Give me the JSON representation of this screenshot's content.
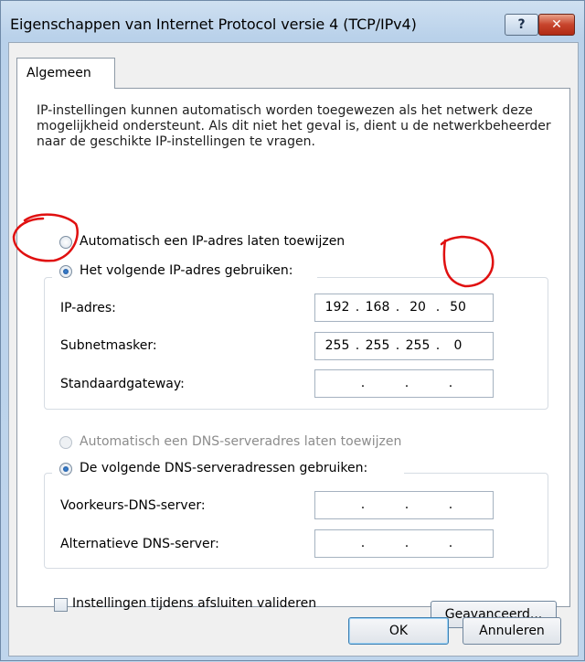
{
  "window": {
    "title": "Eigenschappen van Internet Protocol versie 4 (TCP/IPv4)",
    "help_label": "?",
    "close_label": "✕"
  },
  "tabs": [
    {
      "label": "Algemeen",
      "selected": true
    }
  ],
  "intro_text": "IP-instellingen kunnen automatisch worden toegewezen als het netwerk deze mogelijkheid ondersteunt. Als dit niet het geval is, dient u de netwerkbeheerder naar de geschikte IP-instellingen te vragen.",
  "ip_options": {
    "auto": {
      "label": "Automatisch een IP-adres laten toewijzen",
      "checked": false
    },
    "manual": {
      "label": "Het volgende IP-adres gebruiken:",
      "checked": true
    }
  },
  "ip_fields": {
    "ip": {
      "label": "IP-adres:",
      "octets": [
        "192",
        "168",
        "20",
        "50"
      ]
    },
    "subnet": {
      "label": "Subnetmasker:",
      "octets": [
        "255",
        "255",
        "255",
        "0"
      ]
    },
    "gateway": {
      "label": "Standaardgateway:",
      "octets": [
        "",
        "",
        "",
        ""
      ]
    }
  },
  "dns_options": {
    "auto": {
      "label": "Automatisch een DNS-serveradres laten toewijzen",
      "checked": false,
      "disabled": true
    },
    "manual": {
      "label": "De volgende DNS-serveradressen gebruiken:",
      "checked": true
    }
  },
  "dns_fields": {
    "preferred": {
      "label": "Voorkeurs-DNS-server:",
      "octets": [
        "",
        "",
        "",
        ""
      ]
    },
    "alternate": {
      "label": "Alternatieve DNS-server:",
      "octets": [
        "",
        "",
        "",
        ""
      ]
    }
  },
  "validate_checkbox": {
    "label": "Instellingen tijdens afsluiten valideren",
    "checked": false
  },
  "buttons": {
    "advanced": "Geavanceerd...",
    "ok": "OK",
    "cancel": "Annuleren"
  },
  "colors": {
    "annotation": "#e01010",
    "titlebar": "#c5dbf0"
  }
}
